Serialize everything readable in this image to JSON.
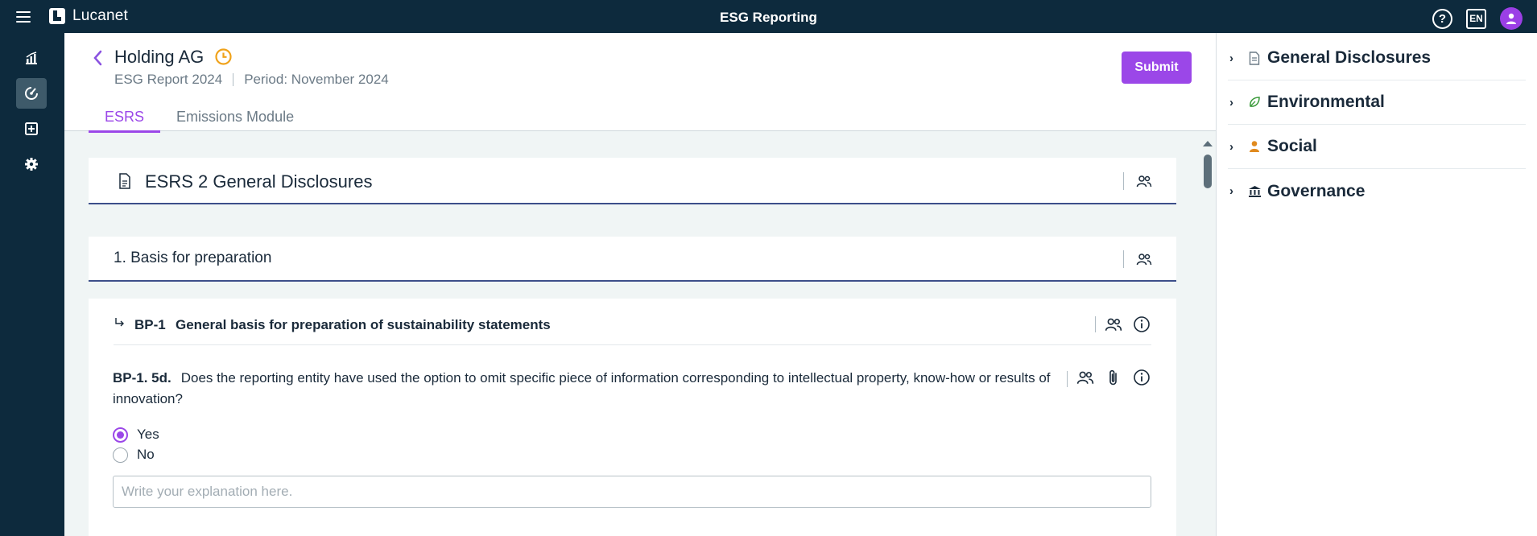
{
  "topbar": {
    "brand": "Lucanet",
    "app_title": "ESG Reporting",
    "language": "EN",
    "help_glyph": "?"
  },
  "rail": {
    "items": [
      {
        "icon": "chart-icon",
        "active": false
      },
      {
        "icon": "reporting-icon",
        "active": true
      },
      {
        "icon": "plus-square-icon",
        "active": false
      },
      {
        "icon": "settings-icon",
        "active": false
      }
    ]
  },
  "header": {
    "title": "Holding AG",
    "report": "ESG Report 2024",
    "period": "Period: November 2024",
    "submit_label": "Submit"
  },
  "tabs": [
    {
      "label": "ESRS",
      "active": true
    },
    {
      "label": "Emissions Module",
      "active": false
    }
  ],
  "content": {
    "section_title": "ESRS 2 General Disclosures",
    "subsection_title": "1. Basis for preparation",
    "disclosure_code": "BP-1",
    "disclosure_title": "General basis for preparation of sustainability statements",
    "question_code": "BP-1. 5d.",
    "question_text": "Does the reporting entity have used the option to omit specific piece of information corresponding to intellectual property, know-how or results of innovation?",
    "options": [
      {
        "label": "Yes",
        "checked": true
      },
      {
        "label": "No",
        "checked": false
      }
    ],
    "explanation_placeholder": "Write your explanation here.",
    "explanation_value": ""
  },
  "rightpanel": {
    "items": [
      {
        "label": "General Disclosures",
        "icon": "document-icon",
        "color": "#6b7a86"
      },
      {
        "label": "Environmental",
        "icon": "leaf-icon",
        "color": "#3a9a3a"
      },
      {
        "label": "Social",
        "icon": "person-icon",
        "color": "#e08a1e"
      },
      {
        "label": "Governance",
        "icon": "institution-icon",
        "color": "#1a2a3a"
      }
    ]
  },
  "colors": {
    "topbar": "#0d2a3d",
    "accent": "#9b47e8",
    "clock": "#f0a21a"
  }
}
